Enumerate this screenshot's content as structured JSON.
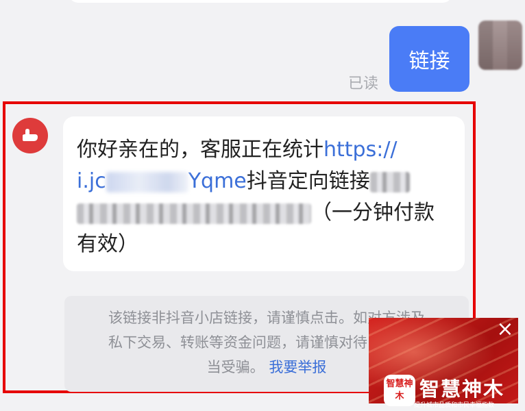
{
  "sent_message": {
    "text": "链接",
    "status": "已读"
  },
  "received_message": {
    "text_part1": "你好亲在的，客服正在统计",
    "link_start": "https://",
    "link_mid": "i.jc",
    "link_end": "Yqme",
    "text_part2": "抖音定向链接",
    "text_part3": "（一分钟付款",
    "text_part4": "有效）"
  },
  "warning": {
    "line1": "该链接非抖音小店链接，请谨慎点击。如对方涉及",
    "line2": "私下交易、转账等资金问题，请谨慎对待，谨防上",
    "line3": "当受骗。",
    "report_label": "我要举报"
  },
  "watermark": {
    "logo_text": "智慧神木",
    "title": "智慧神木",
    "subtitle": "提升城市品质和市民幸福指数"
  },
  "colors": {
    "accent_blue": "#4a7cf6",
    "link_blue": "#3b6fd8",
    "highlight_red": "#e60000",
    "avatar_red": "#de3b3b"
  },
  "icons": {
    "close": "close-icon",
    "shop_avatar": "shop-bag-icon"
  }
}
